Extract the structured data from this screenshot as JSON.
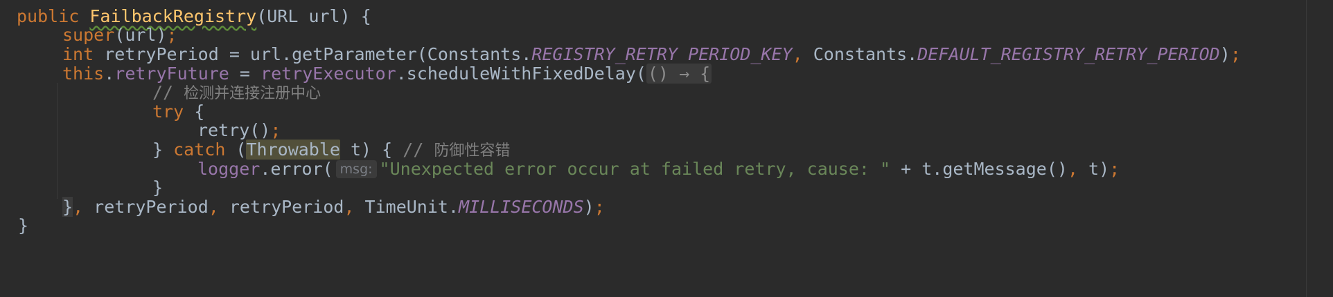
{
  "code": {
    "line1": {
      "kw_public": "public",
      "method_name": "FailbackRegistry",
      "params": "(URL url) {"
    },
    "line2": {
      "kw_super": "super",
      "args": "(url)",
      "semi": ";"
    },
    "line3": {
      "kw_int": "int",
      "mid": " retryPeriod = url.getParameter(Constants.",
      "const1": "REGISTRY_RETRY_PERIOD_KEY",
      "comma": ",",
      "mid2": " Constants.",
      "const2": "DEFAULT_REGISTRY_RETRY_PERIOD",
      "end": ")",
      "semi": ";"
    },
    "line4": {
      "kw_this": "this",
      "dot": ".",
      "field1": "retryFuture",
      "eq": " = ",
      "field2": "retryExecutor",
      "call": ".scheduleWithFixedDelay(",
      "lambda": "() → {"
    },
    "line5": {
      "comment_prefix": "// ",
      "comment_text": "检测并连接注册中心"
    },
    "line6": {
      "kw_try": "try",
      "brace": " {"
    },
    "line7": {
      "call": "retry()",
      "semi": ";"
    },
    "line8": {
      "close": "} ",
      "kw_catch": "catch",
      "open": " (",
      "type": "Throwable",
      "rest": " t) { ",
      "comment_prefix": "// ",
      "comment_text": "防御性容错"
    },
    "line9": {
      "field": "logger",
      "call": ".error(",
      "hint": "msg:",
      "string": "\"Unexpected error occur at failed retry, cause: \"",
      "rest": " + t.getMessage()",
      "comma": ",",
      "t": " t)",
      "semi": ";"
    },
    "line10": {
      "close": "}"
    },
    "line11": {
      "brace": "}",
      "comma1": ",",
      "arg1": " retryPeriod",
      "comma2": ",",
      "arg2": " retryPeriod",
      "comma3": ",",
      "arg3": " TimeUnit.",
      "const": "MILLISECONDS",
      "end": ")",
      "semi": ";"
    },
    "line12": {
      "close": "}"
    }
  },
  "colors": {
    "background": "#2b2b2b",
    "text": "#a9b7c6",
    "keyword": "#cc7832",
    "method": "#ffc66d",
    "field": "#9876aa",
    "string": "#6a8759",
    "comment": "#808080"
  }
}
